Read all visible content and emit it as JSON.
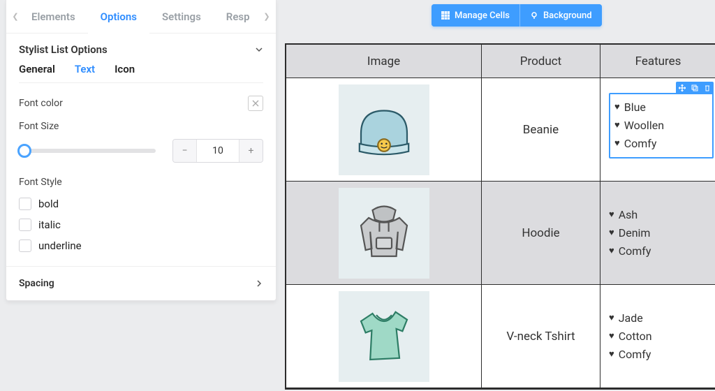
{
  "panel": {
    "tabs": [
      "Elements",
      "Options",
      "Settings",
      "Resp"
    ],
    "active_tab": 1,
    "section_title": "Stylist List Options",
    "subtabs": {
      "general": "General",
      "text": "Text",
      "icon": "Icon"
    },
    "font_color_label": "Font color",
    "font_size_label": "Font Size",
    "font_size_value": "10",
    "font_style_label": "Font Style",
    "style_opts": {
      "bold": "bold",
      "italic": "italic",
      "underline": "underline"
    },
    "spacing_label": "Spacing"
  },
  "toolbar": {
    "manage_cells": "Manage Cells",
    "background": "Background"
  },
  "table": {
    "headers": {
      "image": "Image",
      "product": "Product",
      "features": "Features"
    },
    "rows": [
      {
        "product": "Beanie",
        "features": [
          "Blue",
          "Woollen",
          "Comfy"
        ]
      },
      {
        "product": "Hoodie",
        "features": [
          "Ash",
          "Denim",
          "Comfy"
        ]
      },
      {
        "product": "V-neck Tshirt",
        "features": [
          "Jade",
          "Cotton",
          "Comfy"
        ]
      }
    ],
    "alt_index": 1,
    "selected_features_row": 0
  },
  "icons": {
    "heart": "♥"
  }
}
